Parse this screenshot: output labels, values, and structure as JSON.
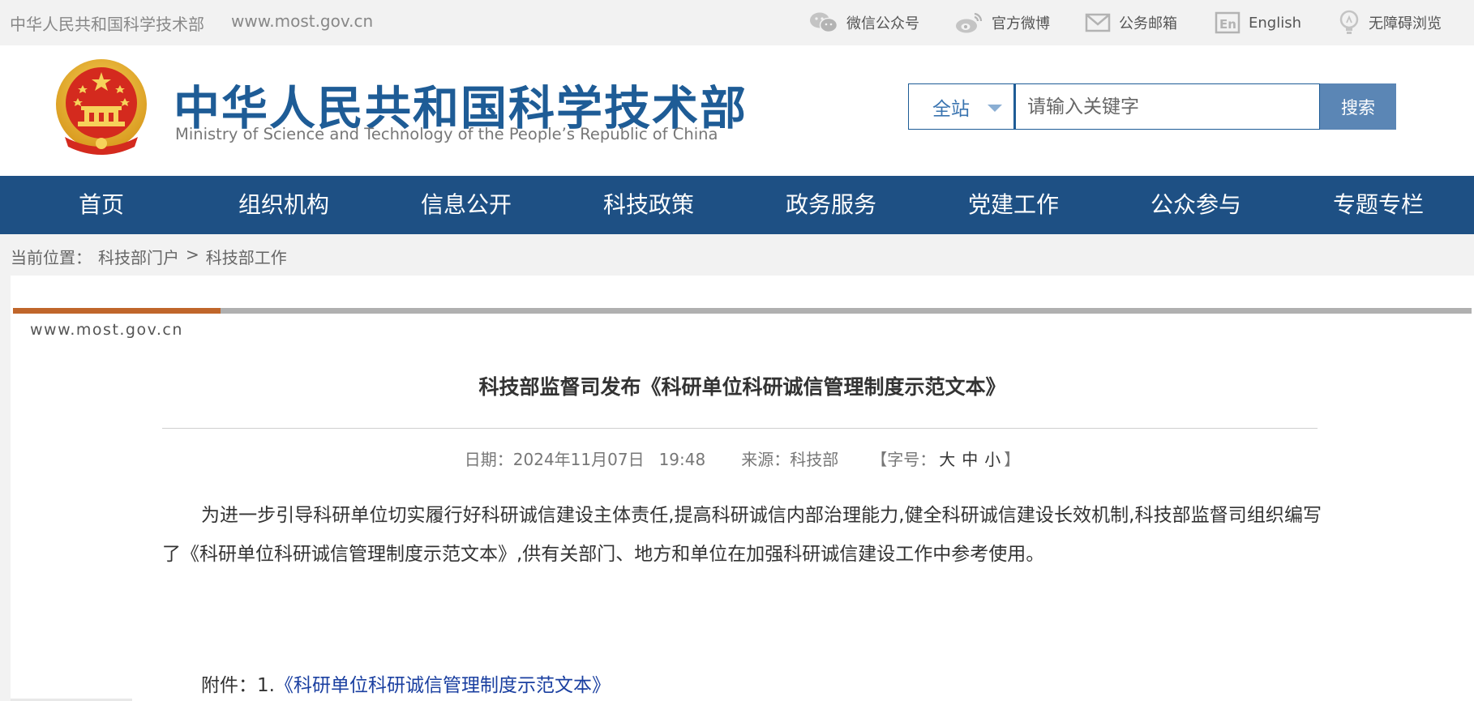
{
  "topbar": {
    "site_name": "中华人民共和国科学技术部",
    "site_url": "www.most.gov.cn",
    "links": {
      "wechat": "微信公众号",
      "weibo": "官方微博",
      "mail": "公务邮箱",
      "english": "English",
      "accessibility": "无障碍浏览"
    }
  },
  "header": {
    "title": "中华人民共和国科学技术部",
    "subtitle": "Ministry of Science and Technology of the People’s Republic of China"
  },
  "search": {
    "scope": "全站",
    "placeholder": "请输入关键字",
    "button": "搜索"
  },
  "nav": {
    "items": [
      "首页",
      "组织机构",
      "信息公开",
      "科技政策",
      "政务服务",
      "党建工作",
      "公众参与",
      "专题专栏"
    ]
  },
  "breadcrumb": {
    "label": "当前位置：",
    "items": [
      "科技部门户",
      "科技部工作"
    ],
    "separator": ">"
  },
  "article": {
    "watermark": "www.most.gov.cn",
    "title": "科技部监督司发布《科研单位科研诚信管理制度示范文本》",
    "date_label": "日期：",
    "date": "2024年11月07日",
    "time": "19:48",
    "source_label": "来源：",
    "source": "科技部",
    "fontsize_open": "【字号：",
    "fontsize_large": "大",
    "fontsize_medium": "中",
    "fontsize_small": "小",
    "fontsize_close": "】",
    "body": "为进一步引导科研单位切实履行好科研诚信建设主体责任,提高科研诚信内部治理能力,健全科研诚信建设长效机制,科技部监督司组织编写了《科研单位科研诚信管理制度示范文本》,供有关部门、地方和单位在加强科研诚信建设工作中参考使用。",
    "attachment_label": "附件：1.",
    "attachment_link": "《科研单位科研诚信管理制度示范文本》"
  },
  "colors": {
    "brand_blue": "#1e5c96",
    "nav_bg": "#1e5084",
    "accent_orange": "#c0662b",
    "link_blue": "#1a3fa0"
  },
  "icons": [
    "wechat-icon",
    "weibo-icon",
    "mail-icon",
    "english-icon",
    "accessibility-icon",
    "national-emblem-icon"
  ]
}
